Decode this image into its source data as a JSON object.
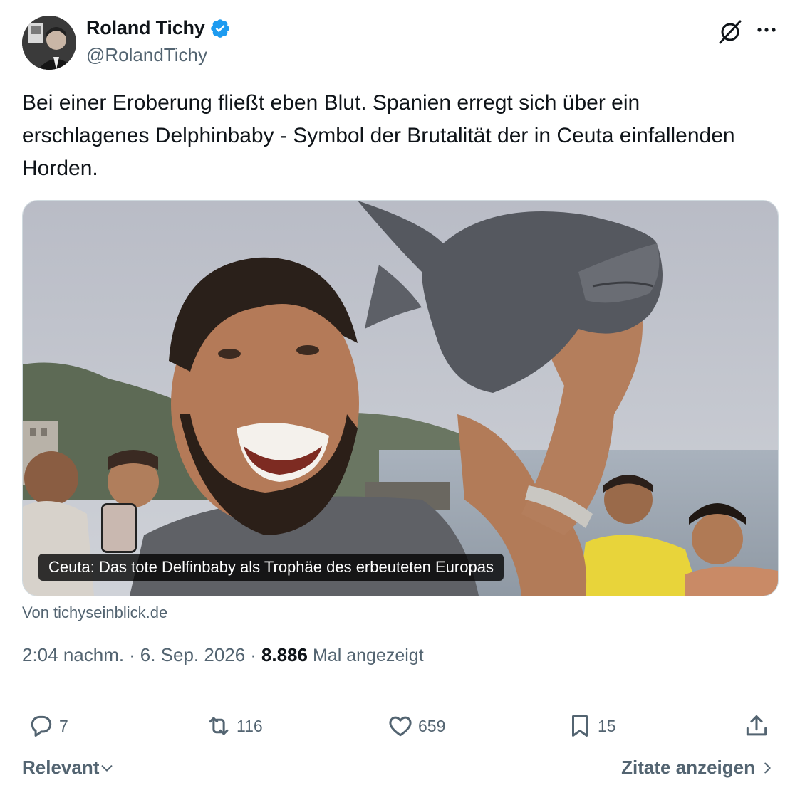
{
  "author": {
    "display_name": "Roland Tichy",
    "handle": "@RolandTichy",
    "verified": true
  },
  "tweet": {
    "text": "Bei einer Eroberung fließt eben Blut. Spanien erregt sich über ein erschlagenes Delphinbaby - Symbol der Brutalität der in Ceuta einfallenden Horden."
  },
  "card": {
    "caption": "Ceuta: Das tote Delfinbaby als Trophäe des erbeuteten Europas",
    "source": "Von tichyseinblick.de"
  },
  "meta": {
    "time": "2:04 nachm.",
    "date": "6. Sep. 2026",
    "separator": "·",
    "views_count": "8.886",
    "views_label": "Mal angezeigt"
  },
  "actions": {
    "replies": "7",
    "reposts": "116",
    "likes": "659",
    "bookmarks": "15"
  },
  "footer": {
    "sort_label": "Relevant",
    "quotes_label": "Zitate anzeigen"
  },
  "colors": {
    "text_primary": "#0f1419",
    "text_secondary": "#536471",
    "verified_blue": "#1d9bf0",
    "divider": "#eff3f4"
  },
  "icons": [
    "grok-icon",
    "more-icon",
    "verified-badge-icon",
    "reply-icon",
    "repost-icon",
    "like-icon",
    "bookmark-icon",
    "share-icon",
    "chevron-down-icon",
    "chevron-right-icon"
  ]
}
